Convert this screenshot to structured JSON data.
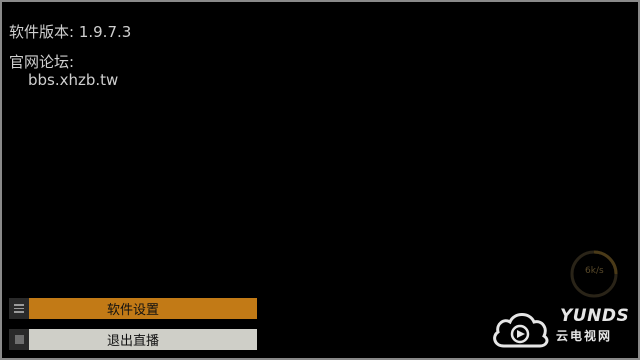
{
  "info": {
    "version_label": "软件版本: ",
    "version_value": "1.9.7.3",
    "forum_label": "官网论坛:",
    "forum_url": "bbs.xhzb.tw"
  },
  "menu": {
    "settings_label": "软件设置",
    "exit_label": "退出直播"
  },
  "speed": {
    "text": "6k/s"
  },
  "watermark": {
    "brand": "YUNDS",
    "subtitle": "云电视网"
  },
  "colors": {
    "background": "#000000",
    "settings_button": "#c27a16",
    "exit_button": "#cfcfc8",
    "text": "#cfcfcf"
  },
  "icons": {
    "settings": "hamburger-icon",
    "exit": "stop-square-icon",
    "watermark": "cloud-play-logo"
  }
}
